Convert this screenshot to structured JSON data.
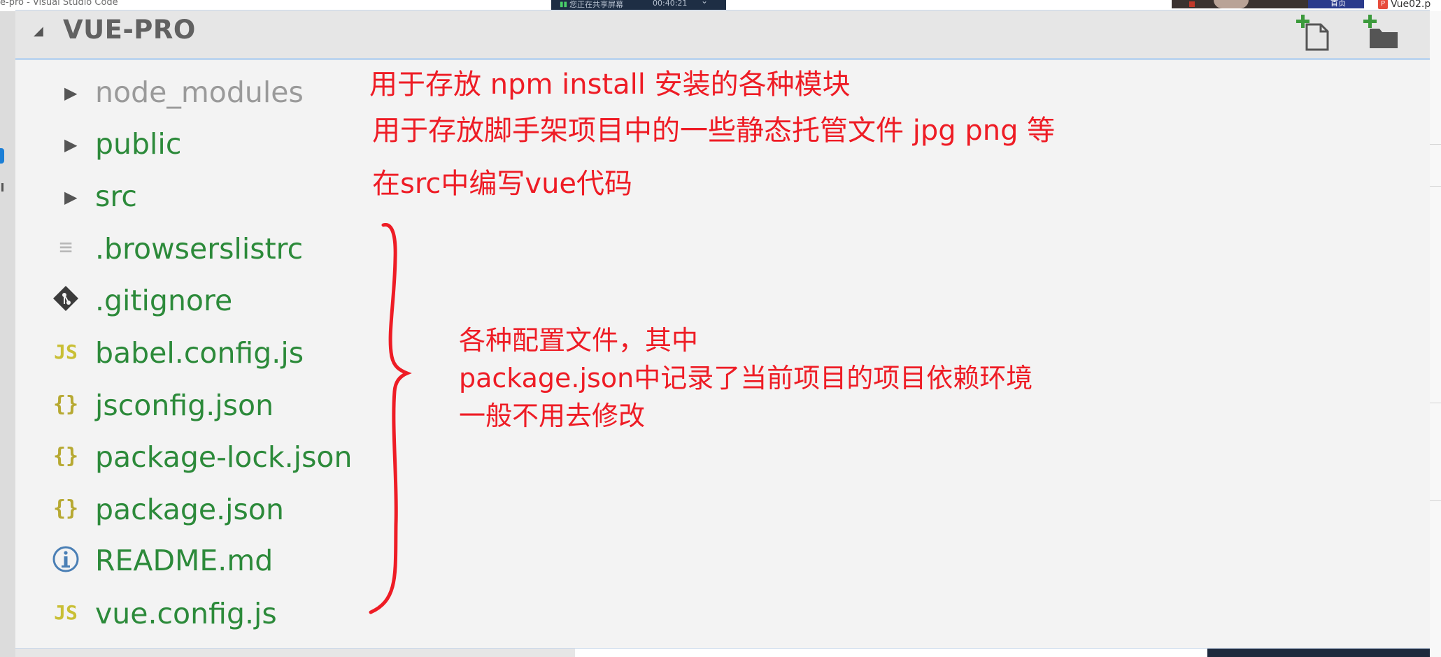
{
  "window": {
    "title": "e-pro - Visual Studio Code",
    "share_text": "您正在共享屏幕",
    "share_time": "00:40:21",
    "home_tab": "首页",
    "vue_tab": "Vue02.p"
  },
  "explorer": {
    "section_title": "VUE-PRO",
    "buttons": {
      "new_file": "new-file-icon",
      "new_folder": "new-folder-icon"
    },
    "items": [
      {
        "label": "node_modules",
        "type": "folder"
      },
      {
        "label": "public",
        "type": "folder"
      },
      {
        "label": "src",
        "type": "folder"
      },
      {
        "label": ".browserslistrc",
        "icon": "lines-icon",
        "icon_text": "≡"
      },
      {
        "label": ".gitignore",
        "icon": "git-icon"
      },
      {
        "label": "babel.config.js",
        "icon": "js-icon",
        "icon_text": "JS"
      },
      {
        "label": "jsconfig.json",
        "icon": "json-icon",
        "icon_text": "{}"
      },
      {
        "label": "package-lock.json",
        "icon": "json-icon",
        "icon_text": "{}"
      },
      {
        "label": "package.json",
        "icon": "json-icon",
        "icon_text": "{}"
      },
      {
        "label": "README.md",
        "icon": "info-icon"
      },
      {
        "label": "vue.config.js",
        "icon": "js-icon",
        "icon_text": "JS"
      }
    ]
  },
  "annotations": {
    "node_modules_note": "用于存放 npm install 安装的各种模块",
    "public_note": "用于存放脚手架项目中的一些静态托管文件    jpg png 等",
    "src_note": "在src中编写vue代码",
    "config_note": "各种配置文件，其中\npackage.json中记录了当前项目的项目依赖环境\n一般不用去修改"
  },
  "colors": {
    "annotation": "#ee1c25",
    "file_name": "#2c8a3a",
    "dimmed": "#9a9a9a",
    "panel_bg": "#f3f3f3",
    "header_bg": "#e6e6e6"
  }
}
